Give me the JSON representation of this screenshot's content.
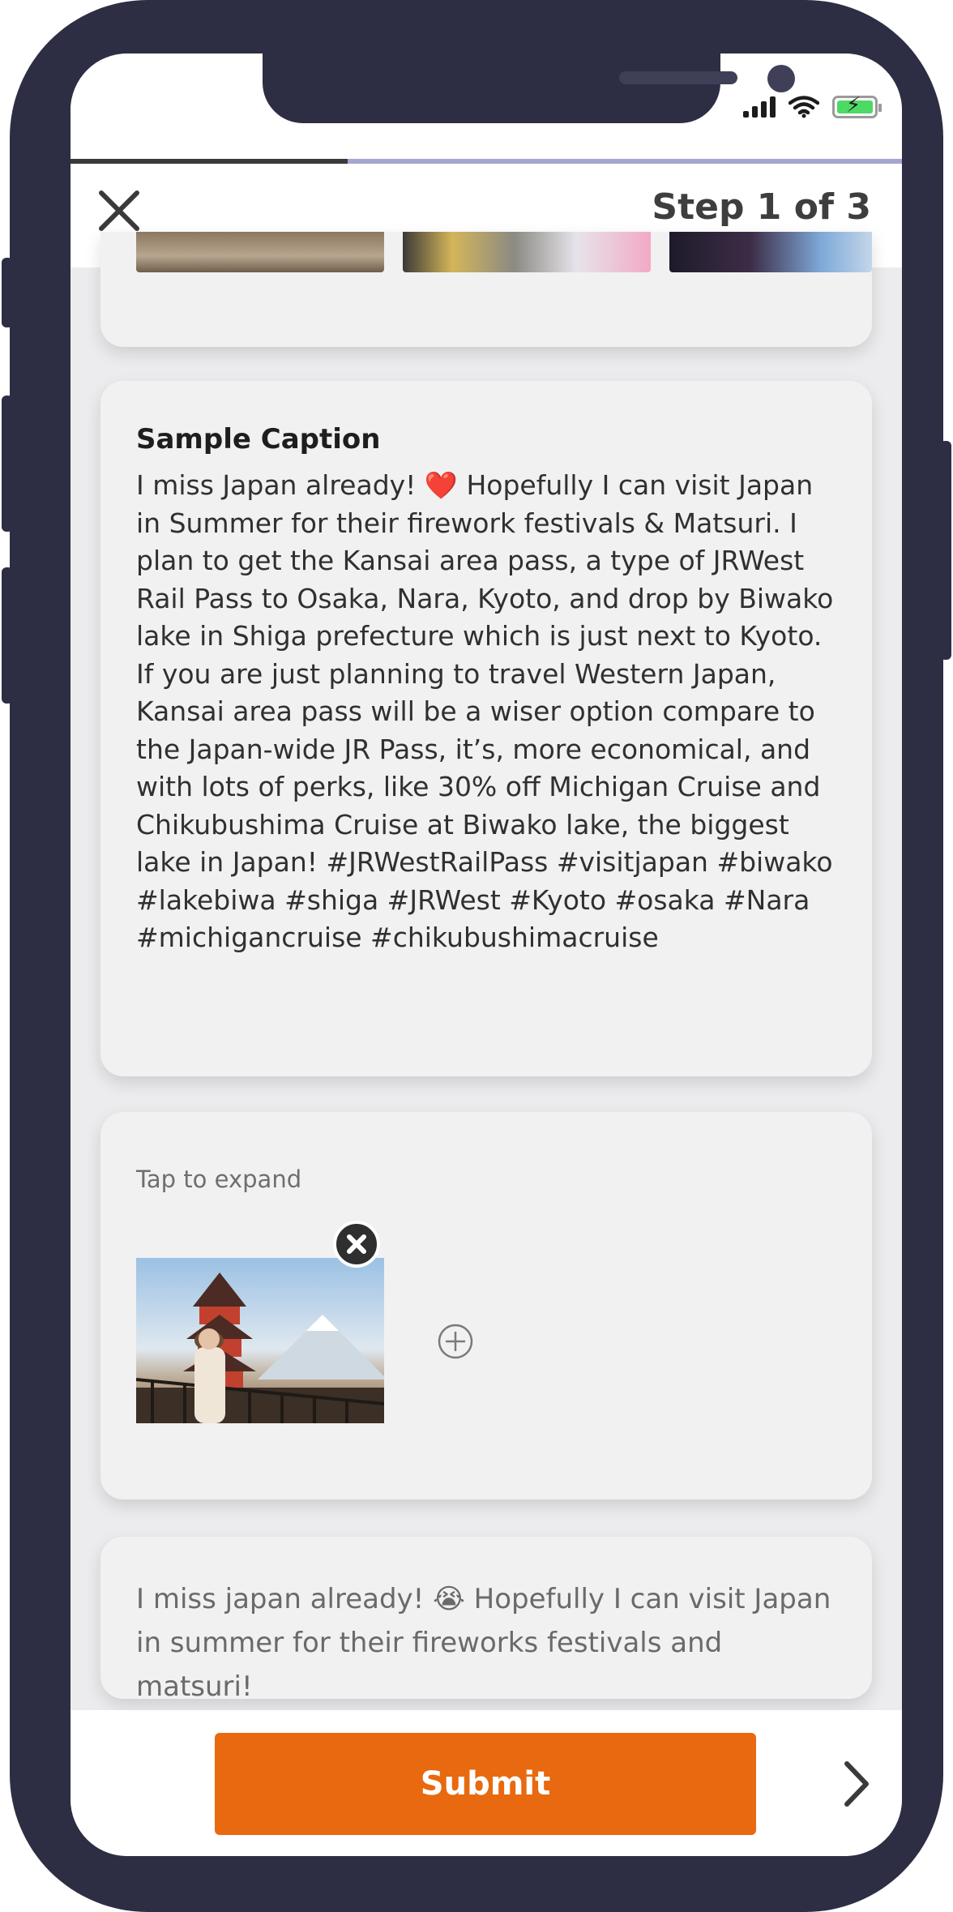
{
  "header": {
    "step_label": "Step 1 of 3",
    "progress_fraction": 0.333
  },
  "caption_card": {
    "title": "Sample Caption",
    "text": "I miss Japan already! ❤️ Hopefully I can visit Japan in Summer for their firework festivals & Matsuri. I plan to get the Kansai area pass, a type of JRWest Rail Pass to Osaka, Nara, Kyoto, and drop by Biwako lake in Shiga prefecture which is just next to Kyoto. If you are just planning to travel Western Japan, Kansai area pass will be a wiser option compare to the Japan-wide JR Pass, it’s, more economical, and with lots of perks, like 30% off Michigan Cruise and Chikubushima Cruise at Biwako lake, the biggest lake in Japan! #JRWestRailPass #visitjapan #biwako #lakebiwa #shiga #JRWest #Kyoto #osaka #Nara #michigancruise #chikubushimacruise"
  },
  "media_card": {
    "tap_label": "Tap to expand"
  },
  "preview_card": {
    "text": "I miss japan already! 😭 Hopefully I can visit Japan in summer for their fireworks festivals and matsuri!"
  },
  "footer": {
    "submit_label": "Submit"
  },
  "icons": {
    "close": "close-icon",
    "remove": "remove-photo-icon",
    "add": "add-photo-icon",
    "next": "chevron-right-icon"
  },
  "colors": {
    "accent": "#e8690f",
    "frame": "#2d2d43",
    "progress_track": "#a3a6cf",
    "progress_fill": "#3a3a3a"
  }
}
